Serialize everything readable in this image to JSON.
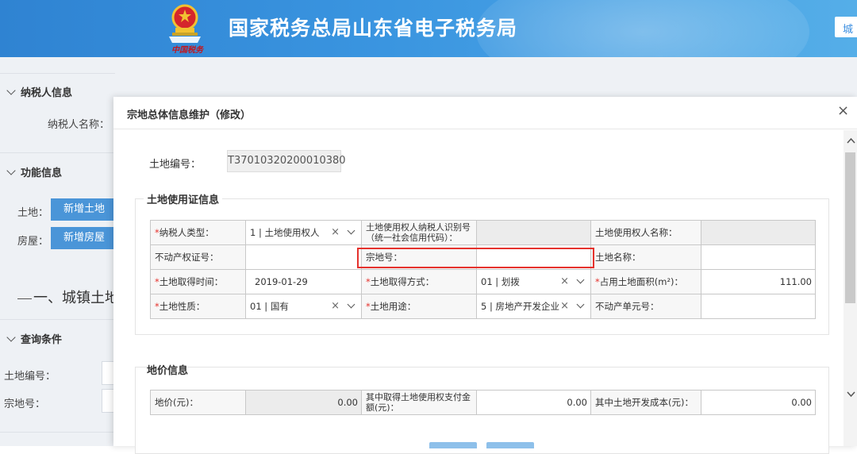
{
  "header": {
    "site_title": "国家税务总局山东省电子税务局",
    "emblem_caption": "中国税务",
    "right_button": "城"
  },
  "background": {
    "section_taxpayer": "纳税人信息",
    "taxpayer_name_label": "纳税人名称：",
    "section_function": "功能信息",
    "land_label": "土地：",
    "add_land_button": "新增土地",
    "house_label": "房屋：",
    "add_house_button": "新增房屋",
    "big_heading": "一、城镇土地使",
    "section_query": "查询条件",
    "query_land_no_label": "土地编号：",
    "query_parcel_no_label": "宗地号："
  },
  "modal": {
    "title": "宗地总体信息维护（修改）",
    "close_icon": "close-icon",
    "land_no_label": "土地编号：",
    "land_no_value": "T37010320200010380",
    "cert_section_title": "土地使用证信息",
    "cert_rows": [
      {
        "c1_label": "纳税人类型：",
        "c1_required": "*",
        "c1_value": "1 | 土地使用权人",
        "c2_label_line1": "土地使用权人纳税人识别号",
        "c2_label_line2": "（统一社会信用代码）：",
        "c2_value": "",
        "c3_label": "土地使用权人名称：",
        "c3_value": ""
      },
      {
        "c1_label": "不动产权证号：",
        "c1_value": "",
        "c2_label": "宗地号：",
        "c2_value": "",
        "c3_label": "土地名称：",
        "c3_value": ""
      },
      {
        "c1_label": "土地取得时间：",
        "c1_required": "*",
        "c1_value": "2019-01-29",
        "c2_label": "土地取得方式：",
        "c2_required": "*",
        "c2_value": "01 | 划拨",
        "c3_label": "占用土地面积(m²)：",
        "c3_required": "*",
        "c3_value": "111.00"
      },
      {
        "c1_label": "土地性质：",
        "c1_required": "*",
        "c1_value": "01 | 国有",
        "c2_label": "土地用途：",
        "c2_required": "*",
        "c2_value": "5 | 房地产开发企业",
        "c3_label": "不动产单元号：",
        "c3_value": ""
      }
    ],
    "price_section_title": "地价信息",
    "price_row": {
      "c1_label": "地价(元)：",
      "c1_value": "0.00",
      "c2_label_line1": "其中取得土地使用权支付金",
      "c2_label_line2": "额(元)：",
      "c2_value": "0.00",
      "c3_label": "其中土地开发成本(元)：",
      "c3_value": "0.00"
    },
    "clear_glyph": "×",
    "scroll_up_glyph": "^",
    "scroll_down_glyph": "v"
  }
}
